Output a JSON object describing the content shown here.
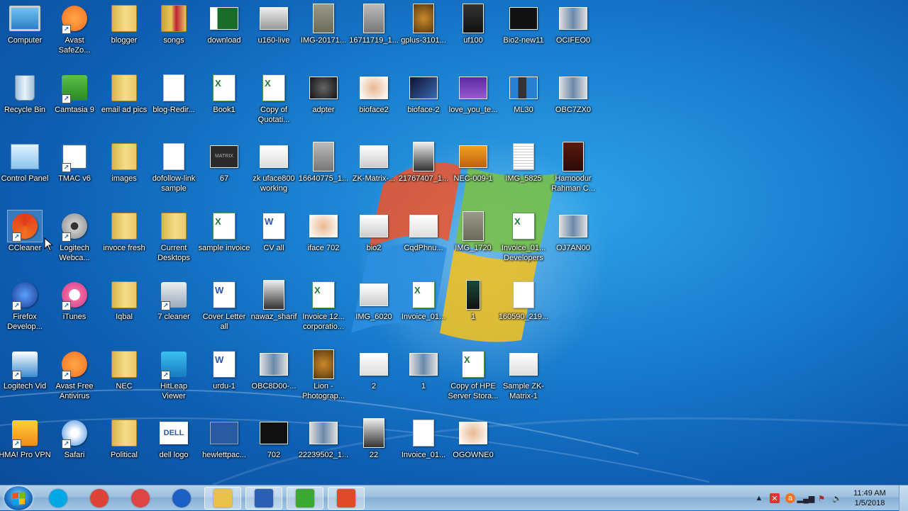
{
  "desktop": {
    "icons": [
      {
        "label": "Computer",
        "kind": "monitor"
      },
      {
        "label": "Avast SafeZo...",
        "kind": "avast",
        "shortcut": true
      },
      {
        "label": "blogger",
        "kind": "folder"
      },
      {
        "label": "songs",
        "kind": "folder-red"
      },
      {
        "label": "download",
        "kind": "pk"
      },
      {
        "label": "u160-live",
        "kind": "device"
      },
      {
        "label": "IMG-20171...",
        "kind": "photo-gray"
      },
      {
        "label": "16711719_1...",
        "kind": "photo-door"
      },
      {
        "label": "gplus-3101...",
        "kind": "photo-lion"
      },
      {
        "label": "uf100",
        "kind": "device-dark"
      },
      {
        "label": "Bio2-new11",
        "kind": "device-black"
      },
      {
        "label": "OCIFEO0",
        "kind": "photo-people"
      },
      {
        "label": "Recycle Bin",
        "kind": "bin"
      },
      {
        "label": "Camtasia 9",
        "kind": "camtasia",
        "shortcut": true
      },
      {
        "label": "email ad pics",
        "kind": "folder"
      },
      {
        "label": "blog-Redir...",
        "kind": "doc"
      },
      {
        "label": "Book1",
        "kind": "xls"
      },
      {
        "label": "Copy of Quotati...",
        "kind": "xls"
      },
      {
        "label": "adpter",
        "kind": "photo-dark"
      },
      {
        "label": "bioface2",
        "kind": "photo-face"
      },
      {
        "label": "bioface-2",
        "kind": "photo-blue"
      },
      {
        "label": "love_you_te...",
        "kind": "photo-purple"
      },
      {
        "label": "ML30",
        "kind": "device-small"
      },
      {
        "label": "OBC7ZX0",
        "kind": "photo-people"
      },
      {
        "label": "Control Panel",
        "kind": "cpanel"
      },
      {
        "label": "TMAC v6",
        "kind": "tmac",
        "shortcut": true
      },
      {
        "label": "images",
        "kind": "folder"
      },
      {
        "label": "dofollow-link sample",
        "kind": "doc"
      },
      {
        "label": "67",
        "kind": "matrix"
      },
      {
        "label": "zk uface800 working",
        "kind": "photo-white"
      },
      {
        "label": "16640775_1...",
        "kind": "photo-door"
      },
      {
        "label": "ZK-Matrix-...",
        "kind": "device-white"
      },
      {
        "label": "21767407_1...",
        "kind": "photo-man"
      },
      {
        "label": "NEC-009-1",
        "kind": "photo-orange"
      },
      {
        "label": "IMG_5825",
        "kind": "doc-list"
      },
      {
        "label": "Hamoodur Rahman C...",
        "kind": "book"
      },
      {
        "label": "CCleaner",
        "kind": "ccleaner",
        "shortcut": true,
        "selected": true
      },
      {
        "label": "Logitech Webca...",
        "kind": "webcam",
        "shortcut": true
      },
      {
        "label": "invoce fresh",
        "kind": "folder"
      },
      {
        "label": "Current Desktops",
        "kind": "folder"
      },
      {
        "label": "sample invoice",
        "kind": "xls"
      },
      {
        "label": "CV all",
        "kind": "docx"
      },
      {
        "label": "iface 702",
        "kind": "photo-face"
      },
      {
        "label": "bio2",
        "kind": "device-white"
      },
      {
        "label": "CqdPhnu...",
        "kind": "photo-white"
      },
      {
        "label": "IMG_1720",
        "kind": "photo-gray"
      },
      {
        "label": "Invoice_01... Developers",
        "kind": "xls"
      },
      {
        "label": "OJ7AN00",
        "kind": "photo-people"
      },
      {
        "label": "Firefox Develop...",
        "kind": "firefox",
        "shortcut": true
      },
      {
        "label": "iTunes",
        "kind": "itunes",
        "shortcut": true
      },
      {
        "label": "Iqbal",
        "kind": "folder"
      },
      {
        "label": "7 cleaner",
        "kind": "gear",
        "shortcut": true
      },
      {
        "label": "Cover Letter all",
        "kind": "docx"
      },
      {
        "label": "nawaz_sharif",
        "kind": "photo-man"
      },
      {
        "label": "Invoice 12... corporatio...",
        "kind": "xls"
      },
      {
        "label": "IMG_6020",
        "kind": "device-white"
      },
      {
        "label": "Invoice_01...",
        "kind": "xls"
      },
      {
        "label": "1",
        "kind": "phone"
      },
      {
        "label": "160590_219...",
        "kind": "doc"
      },
      {
        "label": "Logitech Vid",
        "kind": "logitechvid",
        "shortcut": true
      },
      {
        "label": "Avast Free Antivirus",
        "kind": "avast",
        "shortcut": true
      },
      {
        "label": "NEC",
        "kind": "folder"
      },
      {
        "label": "HitLeap Viewer",
        "kind": "hitleap",
        "shortcut": true
      },
      {
        "label": "urdu-1",
        "kind": "docx"
      },
      {
        "label": "OBC8D00-...",
        "kind": "photo-people"
      },
      {
        "label": "Lion - Photograp...",
        "kind": "photo-lion"
      },
      {
        "label": "2",
        "kind": "photo-white"
      },
      {
        "label": "1",
        "kind": "photo-people"
      },
      {
        "label": "Copy of HPE Server Stora...",
        "kind": "xls"
      },
      {
        "label": "Sample ZK-Matrix-1",
        "kind": "photo-white"
      },
      {
        "label": "HMA! Pro VPN",
        "kind": "hma",
        "shortcut": true
      },
      {
        "label": "Safari",
        "kind": "safari",
        "shortcut": true
      },
      {
        "label": "Political",
        "kind": "folder"
      },
      {
        "label": "dell logo",
        "kind": "dell"
      },
      {
        "label": "hewlettpac...",
        "kind": "hp"
      },
      {
        "label": "702",
        "kind": "device-black"
      },
      {
        "label": "22239502_1...",
        "kind": "photo-people"
      },
      {
        "label": "22",
        "kind": "photo-man"
      },
      {
        "label": "Invoice_01...",
        "kind": "doc"
      },
      {
        "label": "OGOWNE0",
        "kind": "photo-face"
      }
    ]
  },
  "taskbar": {
    "start_icon": "windows-logo-icon",
    "pinned": [
      {
        "name": "skype",
        "color": "#00a8e6"
      },
      {
        "name": "chrome",
        "color": "#db4437"
      },
      {
        "name": "hitleap",
        "color": "#d44"
      },
      {
        "name": "firefox-developer",
        "color": "#1e5fc4"
      },
      {
        "name": "file-explorer",
        "color": "#e8c04a"
      },
      {
        "name": "word",
        "color": "#2b5fb4"
      },
      {
        "name": "camtasia",
        "color": "#3aa832"
      },
      {
        "name": "ccleaner",
        "color": "#e04a2a"
      }
    ],
    "tray": {
      "time": "11:49 AM",
      "date": "1/5/2018"
    }
  }
}
